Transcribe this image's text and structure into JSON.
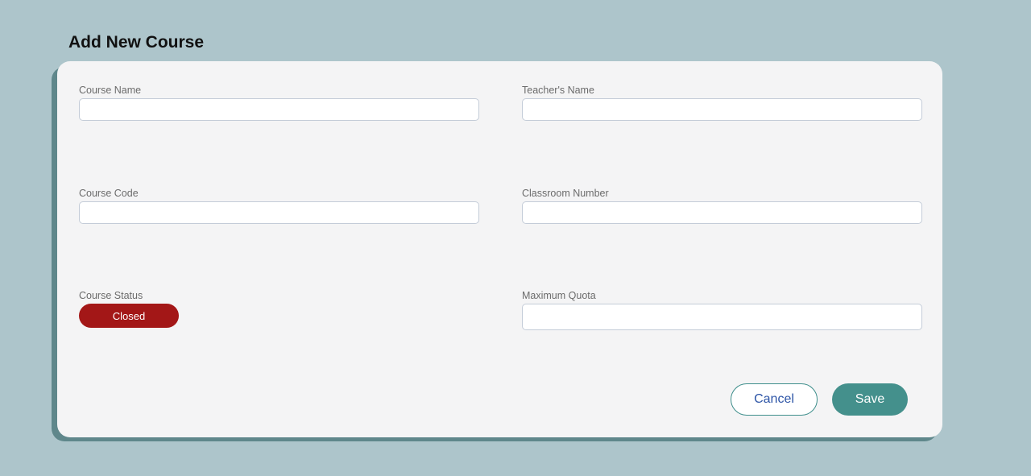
{
  "page": {
    "title": "Add New Course"
  },
  "form": {
    "course_name": {
      "label": "Course Name",
      "value": "",
      "placeholder": ""
    },
    "teacher_name": {
      "label": "Teacher's Name",
      "value": "",
      "placeholder": ""
    },
    "course_code": {
      "label": "Course Code",
      "value": "",
      "placeholder": ""
    },
    "classroom_number": {
      "label": "Classroom Number",
      "value": "",
      "placeholder": ""
    },
    "course_status": {
      "label": "Course Status",
      "value": "Closed",
      "color": "#a31717"
    },
    "maximum_quota": {
      "label": "Maximum Quota",
      "value": "",
      "placeholder": ""
    }
  },
  "actions": {
    "cancel_label": "Cancel",
    "save_label": "Save"
  },
  "colors": {
    "background": "#adc5cb",
    "card": "#f4f4f5",
    "card_shadow": "#5f878b",
    "accent": "#44908c",
    "cancel_text": "#2c54a6",
    "status_closed": "#a31717"
  }
}
